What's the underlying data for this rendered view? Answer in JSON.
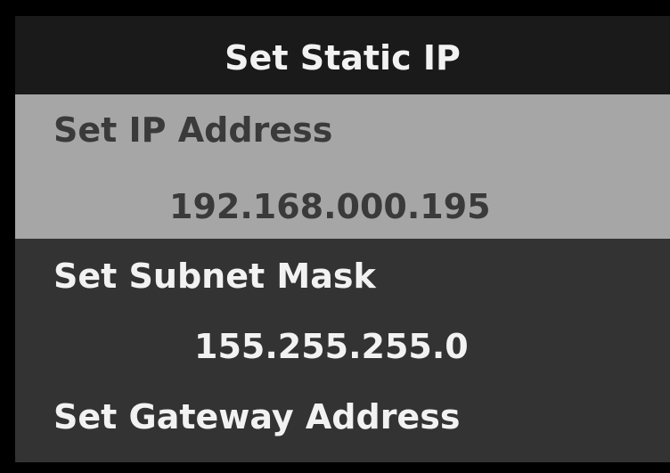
{
  "screen": {
    "title": "Set Static IP"
  },
  "menu": {
    "items": [
      {
        "label": "Set IP Address",
        "value": "192.168.000.195",
        "selected": true
      },
      {
        "label": "Set Subnet Mask",
        "value": "155.255.255.0",
        "selected": false
      },
      {
        "label": "Set Gateway Address",
        "value": "",
        "selected": false
      }
    ]
  },
  "colors": {
    "title_bar": "#1a1a1a",
    "panel": "#333333",
    "selected_row": "#a6a6a6",
    "text_light": "#f2f2f2",
    "text_dark": "#3a3a3a"
  }
}
